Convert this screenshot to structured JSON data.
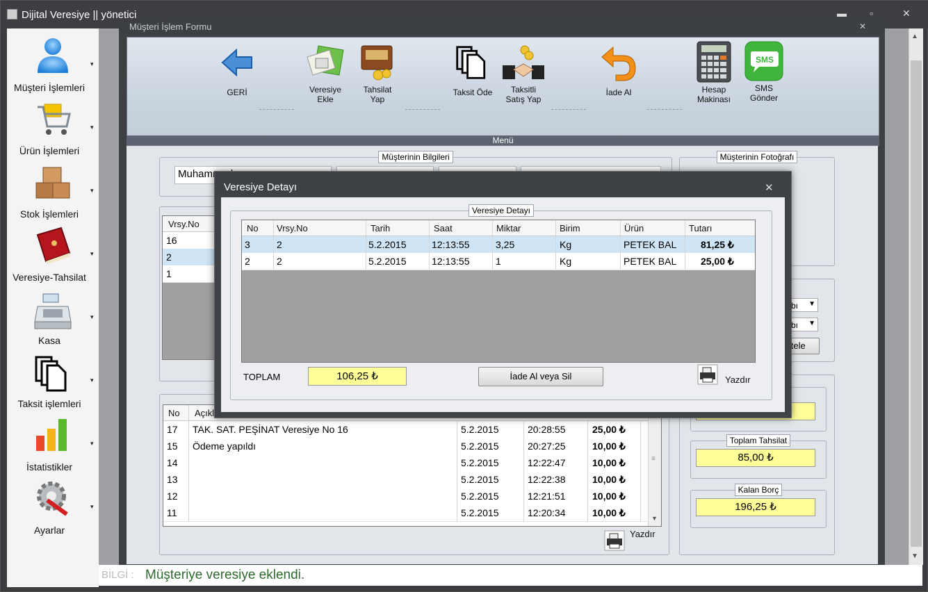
{
  "window": {
    "title": "Dijital Veresiye  ||  yönetici",
    "min": "▬",
    "max": "▫",
    "close": "✕"
  },
  "form": {
    "title": "Müşteri İşlem Formu",
    "close": "✕"
  },
  "sidebar": {
    "items": [
      {
        "label": "Müşteri İşlemleri",
        "icon": "user-icon"
      },
      {
        "label": "Ürün İşlemleri",
        "icon": "cart-icon"
      },
      {
        "label": "Stok İşlemleri",
        "icon": "boxes-icon"
      },
      {
        "label": "Veresiye-Tahsilat",
        "icon": "book-icon"
      },
      {
        "label": "Kasa",
        "icon": "cash-register-icon"
      },
      {
        "label": "Taksit işlemleri",
        "icon": "copy-icon"
      },
      {
        "label": "İstatistikler",
        "icon": "bar-chart-icon"
      },
      {
        "label": "Ayarlar",
        "icon": "settings-icon"
      }
    ],
    "arrow": "▾"
  },
  "menu": {
    "footer": "Menü",
    "buttons": [
      {
        "label": "GERİ",
        "icon": "back-arrow-icon"
      },
      {
        "label": "Veresiye Ekle",
        "icon": "calculator-folder-icon"
      },
      {
        "label": "Tahsilat Yap",
        "icon": "wallet-icon"
      },
      {
        "label": "Taksit Öde",
        "icon": "copy-icon"
      },
      {
        "label": "Taksitli Satış Yap",
        "icon": "handshake-icon"
      },
      {
        "label": "İade Al",
        "icon": "return-icon"
      },
      {
        "label": "Hesap Makinası",
        "icon": "calculator-icon"
      },
      {
        "label": "SMS Gönder",
        "icon": "sms-icon"
      }
    ]
  },
  "customer_info": {
    "legend": "Müşterinin Bilgileri",
    "name_value": "Muhammed"
  },
  "customer_photo": {
    "legend": "Müşterinin Fotoğrafı"
  },
  "veresiye_list": {
    "header": "Vrsy.No",
    "rows": [
      "16",
      "2",
      "1"
    ]
  },
  "filter": {
    "combo1": "mbı",
    "combo2": "mbı",
    "list_button": "stele"
  },
  "transactions": {
    "headers": [
      "No",
      "Açıkl"
    ],
    "rows": [
      {
        "no": "17",
        "desc": "TAK. SAT. PEŞİNAT Veresiye No 16",
        "date": "5.2.2015",
        "time": "20:28:55",
        "amount": "25,00 ₺"
      },
      {
        "no": "15",
        "desc": "Ödeme yapıldı",
        "date": "5.2.2015",
        "time": "20:27:25",
        "amount": "10,00 ₺"
      },
      {
        "no": "14",
        "desc": "",
        "date": "5.2.2015",
        "time": "12:22:47",
        "amount": "10,00 ₺"
      },
      {
        "no": "13",
        "desc": "",
        "date": "5.2.2015",
        "time": "12:22:38",
        "amount": "10,00 ₺"
      },
      {
        "no": "12",
        "desc": "",
        "date": "5.2.2015",
        "time": "12:21:51",
        "amount": "10,00 ₺"
      },
      {
        "no": "11",
        "desc": "",
        "date": "5.2.2015",
        "time": "12:20:34",
        "amount": "10,00 ₺"
      }
    ],
    "print_label": "Yazdır"
  },
  "totals": {
    "tahsilat_legend": "Toplam Tahsilat",
    "tahsilat_value": "85,00 ₺",
    "kalan_legend": "Kalan Borç",
    "kalan_value": "196,25 ₺"
  },
  "dialog": {
    "title": "Veresiye Detayı",
    "close": "✕",
    "legend": "Veresiye Detayı",
    "headers": [
      "No",
      "Vrsy.No",
      "Tarih",
      "Saat",
      "Miktar",
      "Birim",
      "Ürün",
      "Tutarı"
    ],
    "rows": [
      {
        "no": "3",
        "vrsy": "2",
        "date": "5.2.2015",
        "time": "12:13:55",
        "qty": "3,25",
        "unit": "Kg",
        "product": "PETEK BAL",
        "amount": "81,25 ₺"
      },
      {
        "no": "2",
        "vrsy": "2",
        "date": "5.2.2015",
        "time": "12:13:55",
        "qty": "1",
        "unit": "Kg",
        "product": "PETEK BAL",
        "amount": "25,00 ₺"
      }
    ],
    "total_label": "TOPLAM",
    "total_value": "106,25 ₺",
    "return_button": "İade Al veya Sil",
    "print_label": "Yazdır"
  },
  "status": {
    "prefix": "BİLGİ :",
    "message": "Müşteriye veresiye eklendi."
  }
}
